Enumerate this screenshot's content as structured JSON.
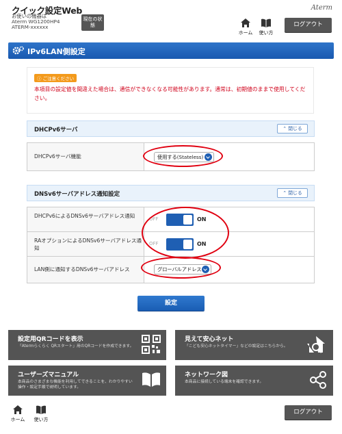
{
  "header": {
    "app_title": "クイック設定Web",
    "device_label": "お使いの機器は",
    "device_model": "Aterm WG1200HP4",
    "device_id": "ATERM-xxxxxx",
    "status_button": "現在の状態",
    "brand": "Aterm",
    "home_label": "ホーム",
    "help_label": "使い方",
    "logout_label": "ログアウト"
  },
  "page": {
    "title": "IPv6LAN側設定"
  },
  "warning": {
    "badge": "ご注意ください",
    "text": "本項目の設定値を間違えた場合は、通信ができなくなる可能性があります。通常は、初期値のままで使用してください。"
  },
  "dhcpv6_section": {
    "title": "DHCPv6サーバ",
    "close_label": "閉じる",
    "row_label": "DHCPv6サーバ機能",
    "row_value": "使用する(Stateless)"
  },
  "dnsv6_section": {
    "title": "DNSv6サーバアドレス通知設定",
    "close_label": "閉じる",
    "rows": [
      {
        "label": "DHCPv6によるDNSv6サーバアドレス通知",
        "off": "OFF",
        "on": "ON",
        "state": "on"
      },
      {
        "label": "RAオプションによるDNSv6サーバアドレス通知",
        "off": "OFF",
        "on": "ON",
        "state": "on"
      },
      {
        "label": "LAN側に通知するDNSv6サーバアドレス",
        "value": "グローバルアドレス"
      }
    ]
  },
  "apply_button": "設定",
  "tiles": [
    {
      "title": "設定用QRコードを表示",
      "desc": "「Atermらくらく QRスタート」用のQRコードを作成できます。",
      "icon": "qr-code-icon"
    },
    {
      "title": "見えて安心ネット",
      "desc": "「こども安心ネットタイマー」などの設定はこちらから。",
      "icon": "home-search-icon"
    },
    {
      "title": "ユーザーズマニュアル",
      "desc": "本商品のさまざまな機能を利用してできることを、わかりやすい操作・設定手順で説明しています。",
      "icon": "book-icon"
    },
    {
      "title": "ネットワーク図",
      "desc": "本商品に接続している端末を確認できます。",
      "icon": "share-network-icon"
    }
  ],
  "footer": {
    "home_label": "ホーム",
    "help_label": "使い方",
    "logout_label": "ログアウト"
  },
  "colors": {
    "accent_blue": "#1f5fb3",
    "warning_red": "#d0021b",
    "highlight_red": "#e00010",
    "tile_bg": "#545454"
  }
}
